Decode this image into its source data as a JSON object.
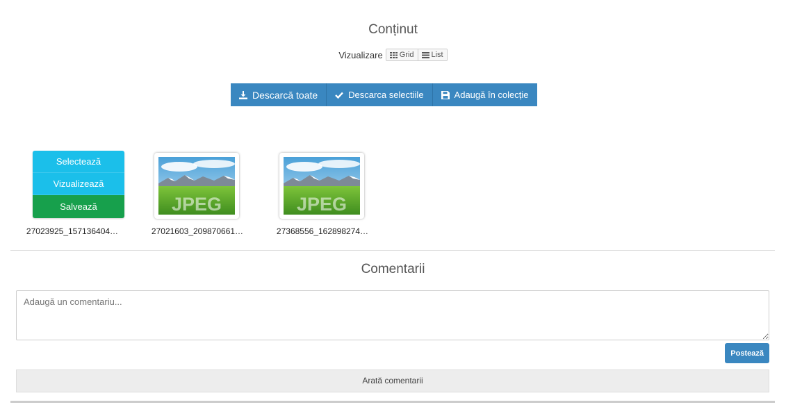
{
  "content": {
    "title": "Conținut",
    "view_label": "Vizualizare",
    "view_grid": "Grid",
    "view_list": "List"
  },
  "actions": {
    "download_all": "Descarcă toate",
    "download_selected": "Descarca selectiile",
    "add_to_collection": "Adaugă în colecție"
  },
  "hover_menu": {
    "select": "Selectează",
    "view": "Vizualizează",
    "save": "Salvează"
  },
  "files": [
    {
      "name": "27023925_157136404…",
      "type": "JPEG"
    },
    {
      "name": "27021603_209870661…",
      "type": "JPEG"
    },
    {
      "name": "27368556_162898274…",
      "type": "JPEG"
    }
  ],
  "comments": {
    "title": "Comentarii",
    "placeholder": "Adaugă un comentariu...",
    "post": "Postează",
    "show": "Arată comentarii"
  },
  "colors": {
    "primary": "#3a87c0",
    "info": "#1bbfea",
    "success": "#17a04c"
  }
}
